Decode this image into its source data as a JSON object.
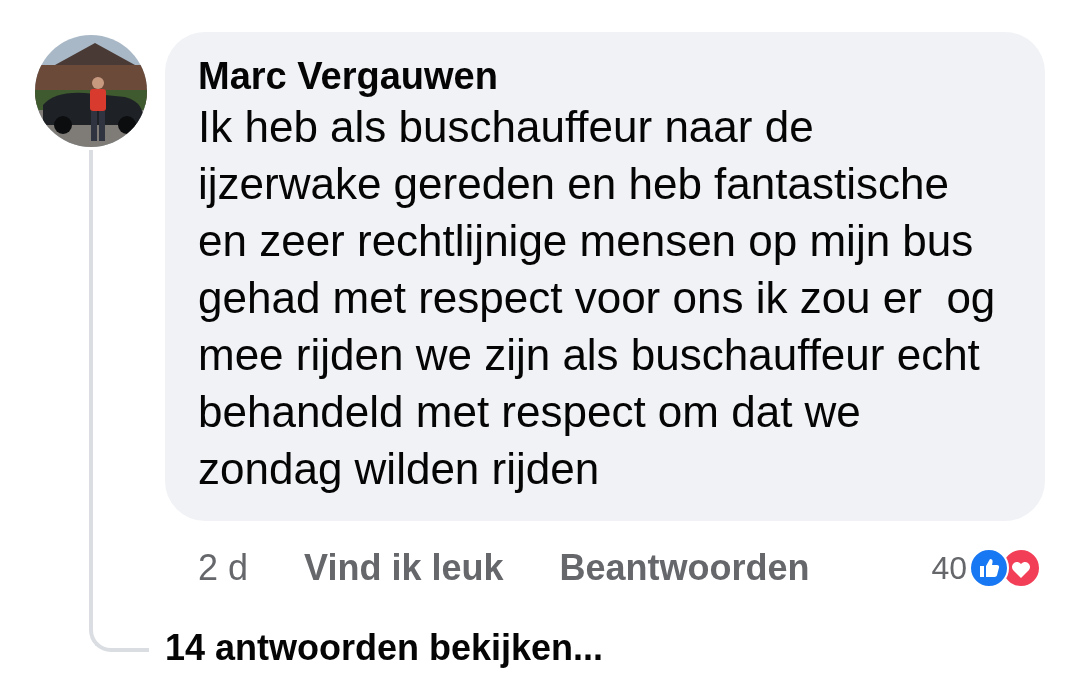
{
  "comment": {
    "author": "Marc Vergauwen",
    "lines": [
      "Ik heb als buschauffeur naar de",
      "ijzerwake gereden en heb fantastische",
      "en zeer rechtlijnige mensen op mijn bus",
      "gehad met respect voor ons ik zou er  og",
      "mee rijden we zijn als buschauffeur echt",
      "behandeld met respect om dat we",
      "zondag wilden rijden"
    ],
    "time": "2 d",
    "actions": [
      "Vind ik leuk",
      "Beantwoorden"
    ],
    "reaction_count": "40",
    "reactions": [
      {
        "kind": "like",
        "color": "#1877f2"
      },
      {
        "kind": "love",
        "color": "#f33e58"
      }
    ]
  },
  "replies_link": "14 antwoorden bekijken..."
}
